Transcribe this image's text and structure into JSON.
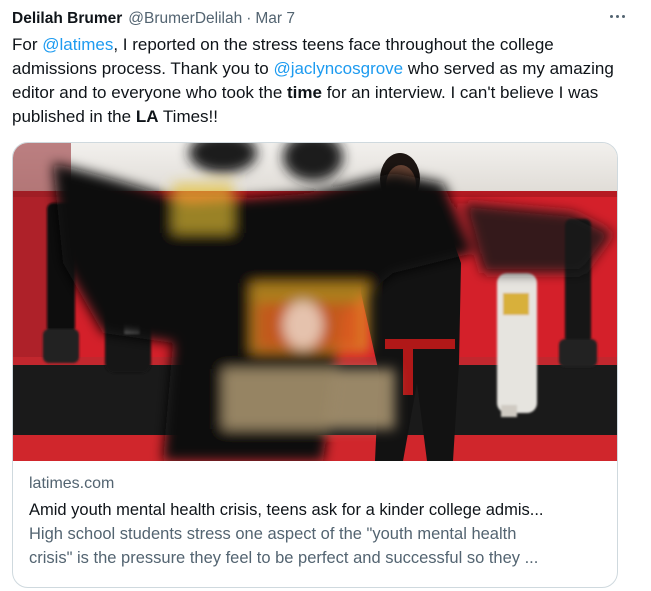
{
  "tweet": {
    "display_name": "Delilah Brumer",
    "handle": "@BrumerDelilah",
    "separator": "·",
    "date": "Mar 7",
    "more_label": "More",
    "text": {
      "p1": "For ",
      "mention1": "@latimes",
      "p2": ", I reported on the stress teens face throughout the college admissions process. Thank you to ",
      "mention2": "@jaclyncosgrove",
      "p3": " who served as my amazing editor and to everyone who took the ",
      "bold1": "time",
      "p4": " for an interview. I can't believe I was published in the ",
      "bold2": "LA",
      "p5": " Times!!"
    }
  },
  "card": {
    "domain": "latimes.com",
    "title": "Amid youth mental health crisis, teens ask for a kinder college admis...",
    "description_line1": "High school students stress one aspect of the \"youth mental health",
    "description_line2": "crisis\" is the pressure they feel to be perfect and successful so they ...",
    "image": {
      "alt": "Martial arts students in black uniforms practicing in a red-walled dojo, one student in focus",
      "colors": {
        "wall": "#d4202a",
        "floor": "#1a1a1a",
        "uniform": "#121212",
        "belt": "#b01818"
      }
    }
  }
}
